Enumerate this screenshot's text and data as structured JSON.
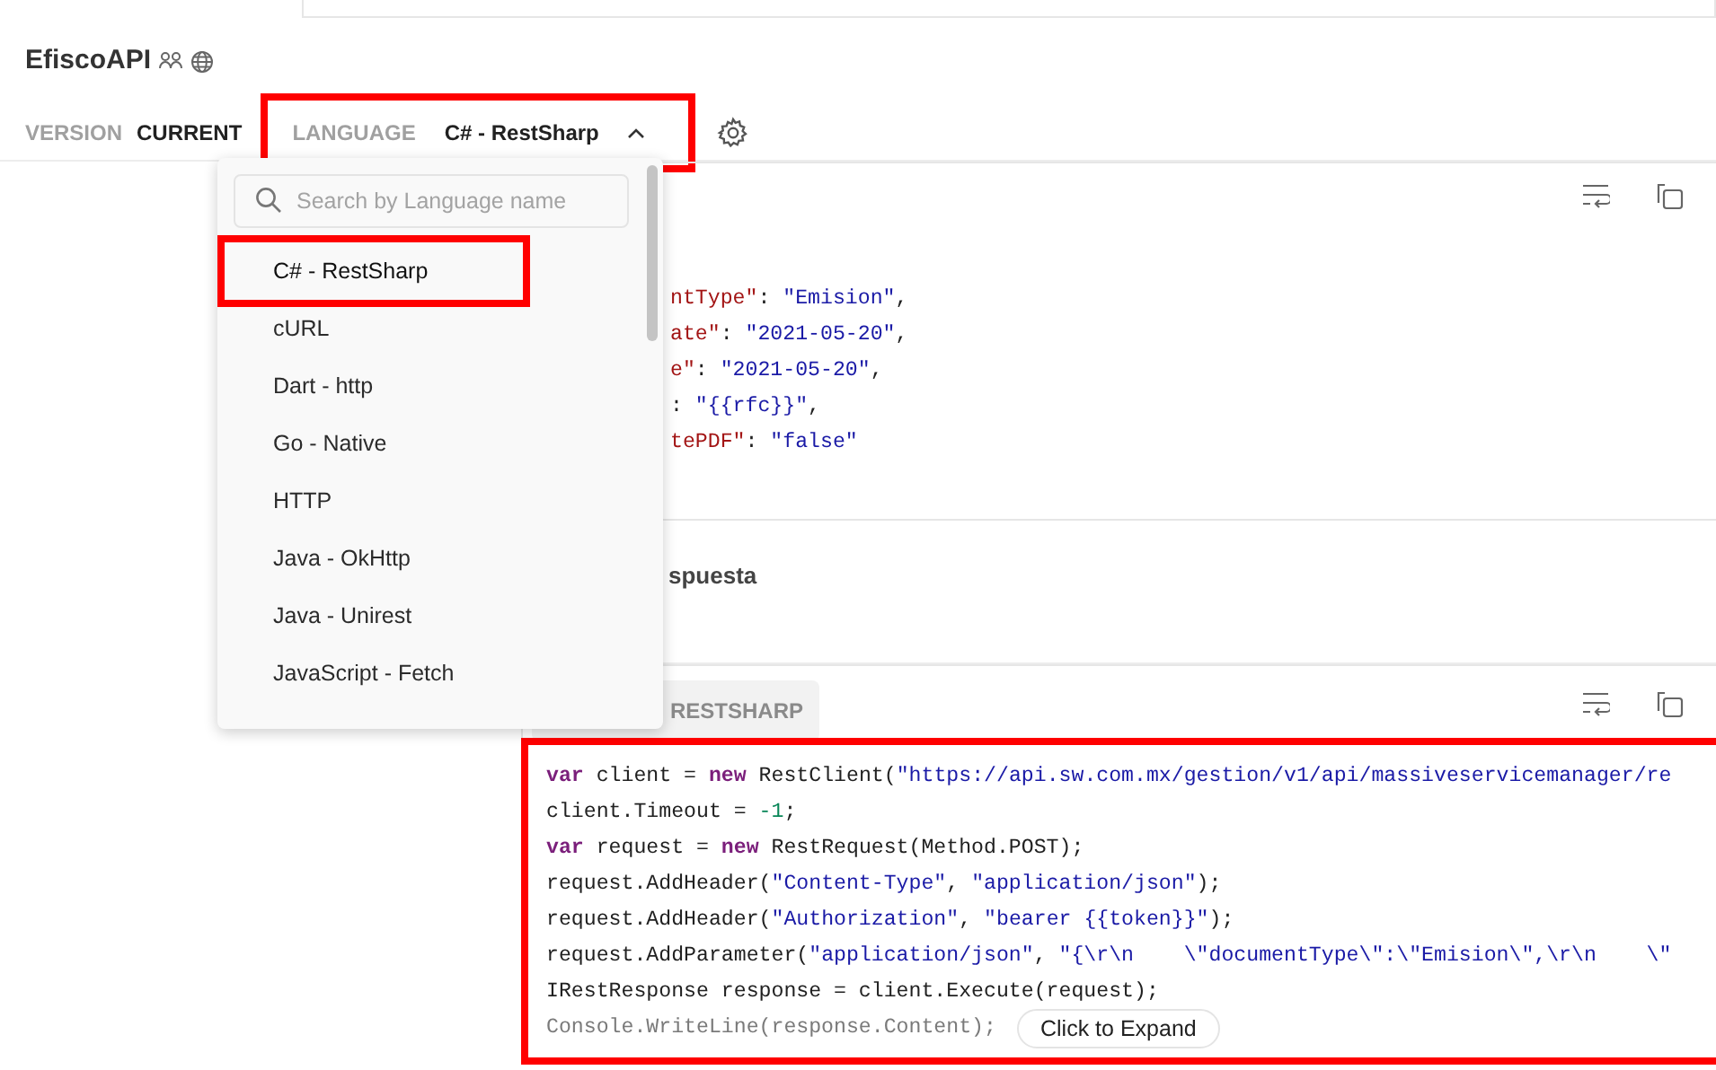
{
  "header": {
    "title": "EfiscoAPI",
    "version_label": "VERSION",
    "version_value": "CURRENT",
    "language_label": "LANGUAGE",
    "language_value": "C# - RestSharp",
    "language_highlighted": true,
    "expanded": true
  },
  "language_menu": {
    "search": {
      "placeholder": "Search by Language name"
    },
    "items": [
      {
        "label": "C# - RestSharp",
        "selected": true,
        "highlighted": true
      },
      {
        "label": "cURL",
        "selected": false,
        "highlighted": false
      },
      {
        "label": "Dart - http",
        "selected": false,
        "highlighted": false
      },
      {
        "label": "Go - Native",
        "selected": false,
        "highlighted": false
      },
      {
        "label": "HTTP",
        "selected": false,
        "highlighted": false
      },
      {
        "label": "Java - OkHttp",
        "selected": false,
        "highlighted": false
      },
      {
        "label": "Java - Unirest",
        "selected": false,
        "highlighted": false
      },
      {
        "label": "JavaScript - Fetch",
        "selected": false,
        "highlighted": false
      }
    ]
  },
  "body_card": {
    "lines": [
      [
        {
          "kind": "key",
          "text": "ntType\""
        },
        {
          "kind": "plain",
          "text": ": "
        },
        {
          "kind": "string",
          "text": "\"Emision\""
        },
        {
          "kind": "plain",
          "text": ","
        }
      ],
      [
        {
          "kind": "key",
          "text": "ate\""
        },
        {
          "kind": "plain",
          "text": ": "
        },
        {
          "kind": "string",
          "text": "\"2021-05-20\""
        },
        {
          "kind": "plain",
          "text": ","
        }
      ],
      [
        {
          "kind": "key",
          "text": "e\""
        },
        {
          "kind": "plain",
          "text": ": "
        },
        {
          "kind": "string",
          "text": "\"2021-05-20\""
        },
        {
          "kind": "plain",
          "text": ","
        }
      ],
      [
        {
          "kind": "plain",
          "text": ": "
        },
        {
          "kind": "string",
          "text": "\"{{rfc}}\""
        },
        {
          "kind": "plain",
          "text": ","
        }
      ],
      [
        {
          "kind": "key",
          "text": "tePDF\""
        },
        {
          "kind": "plain",
          "text": ": "
        },
        {
          "kind": "string",
          "text": "\"false\""
        }
      ]
    ]
  },
  "response_heading": "spuesta",
  "code_card": {
    "tab": "RESTSHARP",
    "highlighted": true,
    "expand_button": "Click to Expand",
    "lines": [
      [
        {
          "kind": "keyword",
          "text": "var"
        },
        {
          "kind": "plain",
          "text": " client = "
        },
        {
          "kind": "keyword",
          "text": "new"
        },
        {
          "kind": "plain",
          "text": " RestClient("
        },
        {
          "kind": "string",
          "text": "\"https://api.sw.com.mx/gestion/v1/api/massiveservicemanager/re"
        }
      ],
      [
        {
          "kind": "plain",
          "text": "client.Timeout = "
        },
        {
          "kind": "number",
          "text": "-1"
        },
        {
          "kind": "plain",
          "text": ";"
        }
      ],
      [
        {
          "kind": "keyword",
          "text": "var"
        },
        {
          "kind": "plain",
          "text": " request = "
        },
        {
          "kind": "keyword",
          "text": "new"
        },
        {
          "kind": "plain",
          "text": " RestRequest(Method.POST);"
        }
      ],
      [
        {
          "kind": "plain",
          "text": "request.AddHeader("
        },
        {
          "kind": "string",
          "text": "\"Content-Type\""
        },
        {
          "kind": "plain",
          "text": ", "
        },
        {
          "kind": "string",
          "text": "\"application/json\""
        },
        {
          "kind": "plain",
          "text": ");"
        }
      ],
      [
        {
          "kind": "plain",
          "text": "request.AddHeader("
        },
        {
          "kind": "string",
          "text": "\"Authorization\""
        },
        {
          "kind": "plain",
          "text": ", "
        },
        {
          "kind": "string",
          "text": "\"bearer {{token}}\""
        },
        {
          "kind": "plain",
          "text": ");"
        }
      ],
      [
        {
          "kind": "plain",
          "text": "request.AddParameter("
        },
        {
          "kind": "string",
          "text": "\"application/json\""
        },
        {
          "kind": "plain",
          "text": ", "
        },
        {
          "kind": "string",
          "text": "\"{\\r\\n    \\\"documentType\\\":\\\"Emision\\\",\\r\\n    \\\""
        }
      ],
      [
        {
          "kind": "plain",
          "text": "IRestResponse response = client.Execute(request);"
        }
      ],
      [
        {
          "kind": "faded",
          "text": "Console.WriteLine(response.Content);"
        }
      ]
    ]
  }
}
